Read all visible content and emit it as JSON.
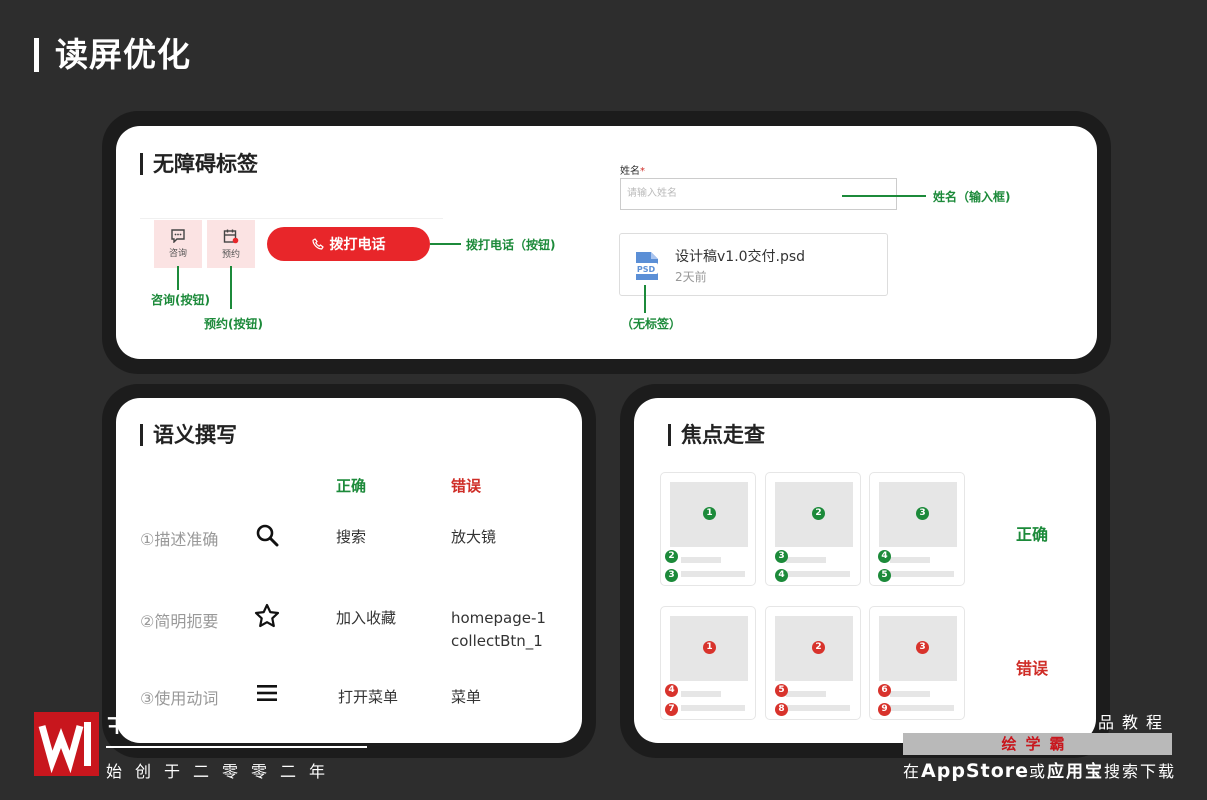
{
  "page": {
    "title": "读屏优化"
  },
  "section_labels": {
    "title": "无障碍标签",
    "consult_label": "咨询",
    "reserve_label": "预约",
    "call_button": "拨打电话",
    "ann_consult": "咨询(按钮)",
    "ann_reserve": "预约(按钮)",
    "ann_call": "拨打电话（按钮)",
    "name_label": "姓名",
    "required_mark": "*",
    "name_placeholder": "请输入姓名",
    "ann_name": "姓名（输入框)",
    "file_name": "设计稿v1.0交付.psd",
    "file_time": "2天前",
    "file_icon_text": "PSD",
    "ann_file": "（无标签）"
  },
  "section_semantic": {
    "title": "语义撰写",
    "col_correct": "正确",
    "col_wrong": "错误",
    "rows": [
      {
        "label": "①描述准确",
        "icon": "search-icon",
        "correct": "搜索",
        "wrong": "放大镜"
      },
      {
        "label": "②简明扼要",
        "icon": "star-icon",
        "correct": "加入收藏",
        "wrong": "homepage-1\ncollectBtn_1"
      },
      {
        "label": "③使用动词",
        "icon": "menu-icon",
        "correct": "打开菜单",
        "wrong": "菜单"
      }
    ]
  },
  "section_focus": {
    "title": "焦点走查",
    "label_correct": "正确",
    "label_wrong": "错误",
    "correct_tiles": [
      {
        "main": "1",
        "a": "2",
        "b": "3"
      },
      {
        "main": "2",
        "a": "3",
        "b": "4"
      },
      {
        "main": "3",
        "a": "4",
        "b": "5"
      }
    ],
    "wrong_tiles": [
      {
        "main": "1",
        "a": "4",
        "b": "7"
      },
      {
        "main": "2",
        "a": "5",
        "b": "8"
      },
      {
        "main": "3",
        "a": "6",
        "b": "9"
      }
    ]
  },
  "watermark": {
    "brand_partial": "王",
    "slogan": "始创于二零零二年",
    "right_top": "品教程",
    "right_badge": "绘学霸",
    "right_bottom_pre": "在",
    "right_bottom_store": "AppStore",
    "right_bottom_mid": "或",
    "right_bottom_app": "应用宝",
    "right_bottom_post": "搜索下载"
  },
  "colors": {
    "background": "#2d2d2d",
    "accent_red": "#e8262a",
    "annotation_green": "#1c8a3a",
    "logo_red": "#c8161d"
  }
}
